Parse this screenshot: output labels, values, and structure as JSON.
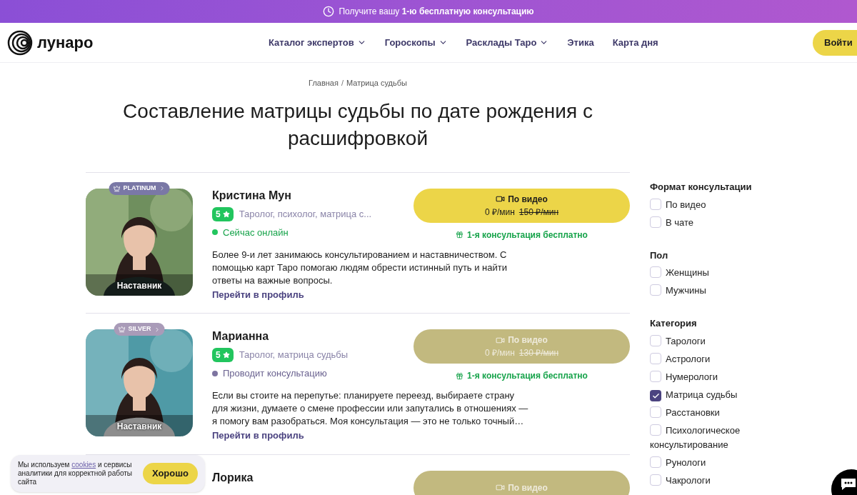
{
  "promo_banner": {
    "text": "Получите вашу **1-ю бесплатную консультацию**"
  },
  "header": {
    "logo": "лунаро",
    "nav": [
      {
        "label": "Каталог экспертов",
        "dropdown": true
      },
      {
        "label": "Гороскопы",
        "dropdown": true
      },
      {
        "label": "Расклады Таро",
        "dropdown": true
      },
      {
        "label": "Этика",
        "dropdown": false
      },
      {
        "label": "Карта дня",
        "dropdown": false
      }
    ],
    "login": "Войти"
  },
  "breadcrumb": {
    "items": [
      "Главная",
      "Матрица судьбы"
    ],
    "separator": "/"
  },
  "title": "Составление матрицы судьбы по дате рождения с расшифровкой",
  "experts": [
    {
      "name": "Кристина Мун",
      "tier": {
        "label": "PLATINUM",
        "color": "#7a78a6"
      },
      "photo_label": "Наставник",
      "rating": "5",
      "specialties": "Таролог, психолог, матрица с...",
      "status": {
        "text": "Сейчас онлайн",
        "color": "#22c55e"
      },
      "available": true,
      "button": "По видео",
      "price": "0 ₽/мин",
      "old_price": "150 ₽/мин",
      "gift": "1-я консультация бесплатно",
      "description": "Более 9-и лет занимаюсь консультированием и наставничеством. С помощью карт Таро помогаю людям обрести истинный путь и найти ответы на важные вопросы.",
      "profile_link": "Перейти в профиль"
    },
    {
      "name": "Марианна",
      "tier": {
        "label": "SILVER",
        "color": "#a99bb8"
      },
      "photo_label": "Наставник",
      "rating": "5",
      "specialties": "Таролог, матрица судьбы",
      "status": {
        "text": "Проводит консультацию",
        "color": "#7d74a0"
      },
      "available": false,
      "button": "По видео",
      "price": "0 ₽/мин",
      "old_price": "130 ₽/мин",
      "gift": "1-я консультация бесплатно",
      "description": "Если вы стоите на перепутье: планируете переезд, выбираете страну для жизни, думаете о смене профессии или запутались в отношениях — я помогу вам разобраться. Моя консультация — это не только точный…",
      "profile_link": "Перейти в профиль"
    },
    {
      "name": "Лорика",
      "available": false,
      "button": "По видео"
    }
  ],
  "filters": [
    {
      "title": "Формат консультации",
      "options": [
        {
          "label": "По видео",
          "checked": false
        },
        {
          "label": "В чате",
          "checked": false
        }
      ]
    },
    {
      "title": "Пол",
      "options": [
        {
          "label": "Женщины",
          "checked": false
        },
        {
          "label": "Мужчины",
          "checked": false
        }
      ]
    },
    {
      "title": "Категория",
      "options": [
        {
          "label": "Тарологи",
          "checked": false
        },
        {
          "label": "Астрологи",
          "checked": false
        },
        {
          "label": "Нумерологи",
          "checked": false
        },
        {
          "label": "Матрица судьбы",
          "checked": true
        },
        {
          "label": "Расстановки",
          "checked": false
        },
        {
          "label": "Психологическое консультирование",
          "checked": false
        },
        {
          "label": "Рунологи",
          "checked": false
        },
        {
          "label": "Чакрологи",
          "checked": false
        }
      ]
    }
  ],
  "cookie_notice": {
    "before": "Мы используем ",
    "link": "cookies",
    "after": " и сервисы аналитики для корректной работы сайта",
    "button": "Хорошо"
  }
}
